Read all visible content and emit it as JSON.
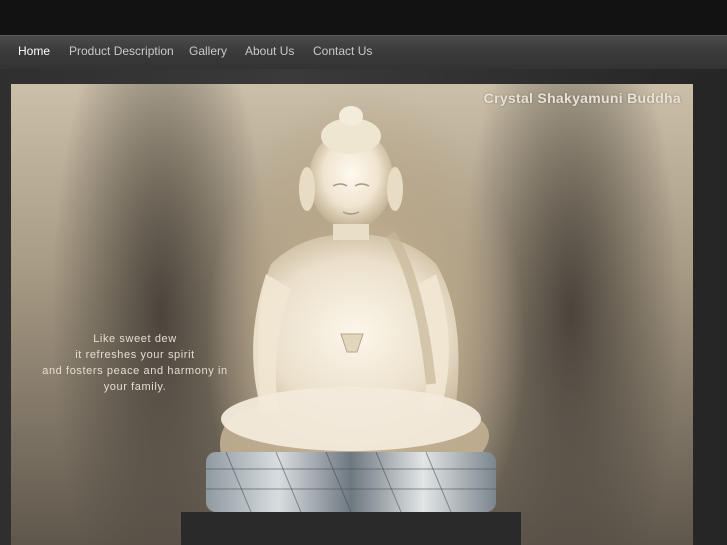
{
  "nav": {
    "items": [
      {
        "label": "Home",
        "active": true
      },
      {
        "label": "Product Description",
        "active": false
      },
      {
        "label": "Gallery",
        "active": false
      },
      {
        "label": "About Us",
        "active": false
      },
      {
        "label": "Contact Us",
        "active": false
      }
    ]
  },
  "hero": {
    "title": "Crystal Shakyamuni Buddha",
    "tagline": [
      "Like sweet dew",
      "it refreshes your spirit",
      "and fosters peace and harmony in",
      "your family."
    ]
  },
  "colors": {
    "topbar": "#121212",
    "nav_text": "#c9c9c9",
    "nav_active": "#ffffff",
    "hero_title": "#e8e2d6"
  }
}
